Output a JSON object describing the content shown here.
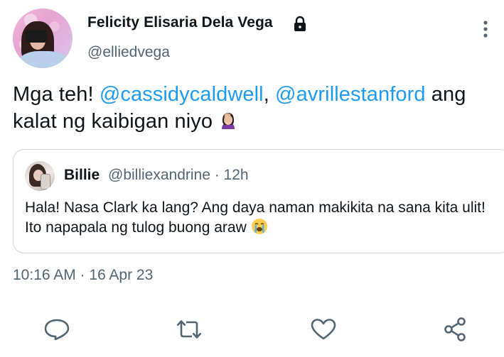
{
  "tweet": {
    "author": {
      "display_name": "Felicity Elisaria Dela Vega",
      "handle": "@elliedvega"
    },
    "text_parts": {
      "lead": "Mga teh! ",
      "mention1": "@cassidycaldwell",
      "comma": ", ",
      "mention2": "@avrillestanford",
      "tail": " ang kalat ng kaibigan niyo "
    },
    "emoji": "facepalm",
    "timestamp": "10:16 AM · 16 Apr 23"
  },
  "quoted_tweet": {
    "display_name": "Billie",
    "meta": "@billiexandrine · 12h",
    "text": "Hala! Nasa Clark ka lang? Ang daya naman makikita na sana kita ulit! Ito napapala ng tulog buong araw ",
    "emoji": "crying"
  },
  "actions": {
    "reply_icon": "reply-icon",
    "retweet_icon": "retweet-icon",
    "like_icon": "like-icon",
    "share_icon": "share-icon"
  },
  "colors": {
    "mention": "#1d9bf0",
    "secondary_text": "#536471",
    "primary_text": "#0f1419",
    "border": "#cfd9de"
  }
}
